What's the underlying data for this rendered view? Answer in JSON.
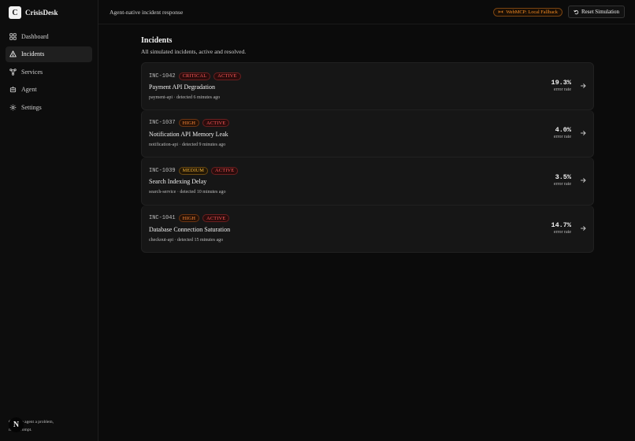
{
  "brand": {
    "logo_letter": "C",
    "name": "CrisisDesk"
  },
  "nav": [
    {
      "label": "Dashboard",
      "icon": "grid-icon",
      "active": false
    },
    {
      "label": "Incidents",
      "icon": "alert-triangle-icon",
      "active": true
    },
    {
      "label": "Services",
      "icon": "network-icon",
      "active": false
    },
    {
      "label": "Agent",
      "icon": "robot-icon",
      "active": false
    },
    {
      "label": "Settings",
      "icon": "gear-icon",
      "active": false
    }
  ],
  "sidebar_footer": {
    "avatar_letter": "N",
    "line1": "Give the agent a problem,",
    "line2": "not a prompt."
  },
  "topbar": {
    "tagline": "Agent-native incident response",
    "webmcp_label": "WebMCP: Local Fallback",
    "reset_label": "Reset Simulation"
  },
  "page": {
    "title": "Incidents",
    "subtitle": "All simulated incidents, active and resolved."
  },
  "incidents": [
    {
      "id": "INC-1042",
      "severity": "CRITICAL",
      "status": "ACTIVE",
      "title": "Payment API Degradation",
      "service": "payment-api",
      "detected": "detected 6 minutes ago",
      "metric_value": "19.3%",
      "metric_label": "error rate"
    },
    {
      "id": "INC-1037",
      "severity": "HIGH",
      "status": "ACTIVE",
      "title": "Notification API Memory Leak",
      "service": "notification-api",
      "detected": "detected 9 minutes ago",
      "metric_value": "4.0%",
      "metric_label": "error rate"
    },
    {
      "id": "INC-1039",
      "severity": "MEDIUM",
      "status": "ACTIVE",
      "title": "Search Indexing Delay",
      "service": "search-service",
      "detected": "detected 10 minutes ago",
      "metric_value": "3.5%",
      "metric_label": "error rate"
    },
    {
      "id": "INC-1041",
      "severity": "HIGH",
      "status": "ACTIVE",
      "title": "Database Connection Saturation",
      "service": "checkout-api",
      "detected": "detected 15 minutes ago",
      "metric_value": "14.7%",
      "metric_label": "error rate"
    }
  ],
  "meta_separator": " · ",
  "colors": {
    "critical": "#ff5a5a",
    "high": "#ff8a3a",
    "medium": "#f6b73c",
    "active": "#ff5a5a",
    "accent_orange": "#f08a24"
  }
}
